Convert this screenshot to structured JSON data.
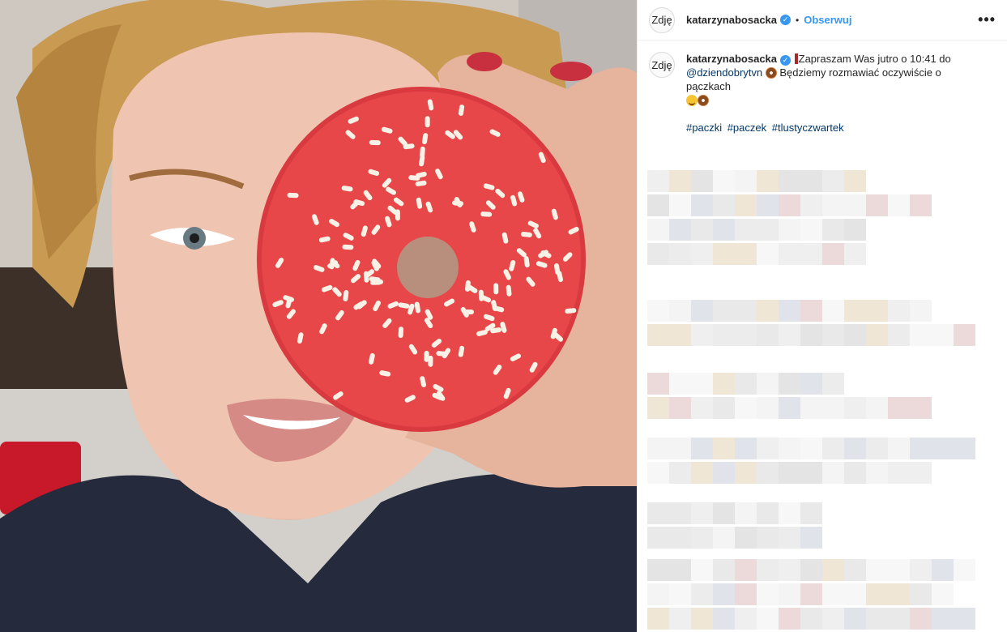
{
  "post": {
    "photo_alt": "",
    "header": {
      "avatar_text": "Zdję",
      "username": "katarzynabosacka",
      "verified_mark": "✓",
      "separator": "•",
      "follow_label": "Obserwuj",
      "more_label": "•••"
    },
    "caption": {
      "avatar_text": "Zdję",
      "username": "katarzynabosacka",
      "text_part1": "Zapraszam Was jutro o 10:41 do",
      "mention": "@dziendobrytvn",
      "text_part2": "Będziemy rozmawiać oczywiście o pączkach",
      "hashtags": [
        "#paczki",
        "#paczek",
        "#tlustyczwartek"
      ]
    }
  },
  "colors": {
    "follow_blue": "#3897f0",
    "link_blue": "#00376b",
    "donut_glaze": "#e8474a"
  }
}
